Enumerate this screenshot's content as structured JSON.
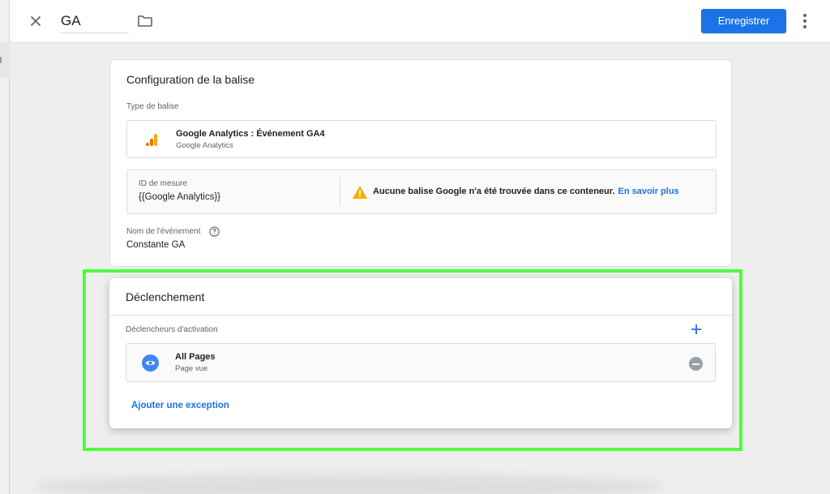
{
  "header": {
    "title_value": "GA",
    "save_label": "Enregistrer"
  },
  "config": {
    "title": "Configuration de la balise",
    "tag_type_label": "Type de balise",
    "tag_name": "Google Analytics : Événement GA4",
    "tag_sub": "Google Analytics",
    "measure_label": "ID de mesure",
    "measure_value": "{{Google Analytics}}",
    "warning_text": "Aucune balise Google n'a été trouvée dans ce conteneur.",
    "warning_link": "En savoir plus",
    "event_label": "Nom de l'événement",
    "event_value": "Constante GA"
  },
  "trigger": {
    "title": "Déclenchement",
    "activation_label": "Déclencheurs d'activation",
    "item_name": "All Pages",
    "item_sub": "Page vue",
    "exception_link": "Ajouter une exception"
  },
  "colors": {
    "accent": "#1a73e8",
    "highlight": "#4cff3a",
    "ga_orange": "#f9ab00",
    "ga_dark_orange": "#e37400",
    "warning": "#f9ab00"
  },
  "icons": [
    "close-icon",
    "folder-icon",
    "more-vert-icon",
    "ga-bar-icon",
    "warning-icon",
    "help-icon",
    "add-icon",
    "eye-icon",
    "remove-icon"
  ]
}
